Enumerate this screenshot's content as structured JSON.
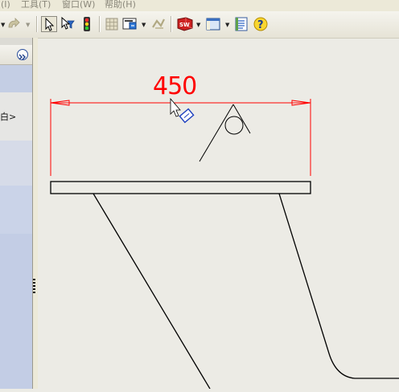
{
  "menu": {
    "items": [
      "(I)",
      "工具(T)",
      "窗口(W)",
      "帮助(H)"
    ]
  },
  "toolbar": {
    "buttons": [
      "redo-icon",
      "select-arrow-icon",
      "select-filter-icon",
      "traffic-light-icon",
      "grid-icon",
      "smart-dimension-icon",
      "disabled-tool-icon",
      "solidworks-icon",
      "view-window-icon",
      "properties-list-icon",
      "help-icon"
    ]
  },
  "panel": {
    "tree_label": "白>"
  },
  "drawing": {
    "dimension_value": "450",
    "dimension_color": "#ff0000",
    "line_color": "#000000"
  }
}
